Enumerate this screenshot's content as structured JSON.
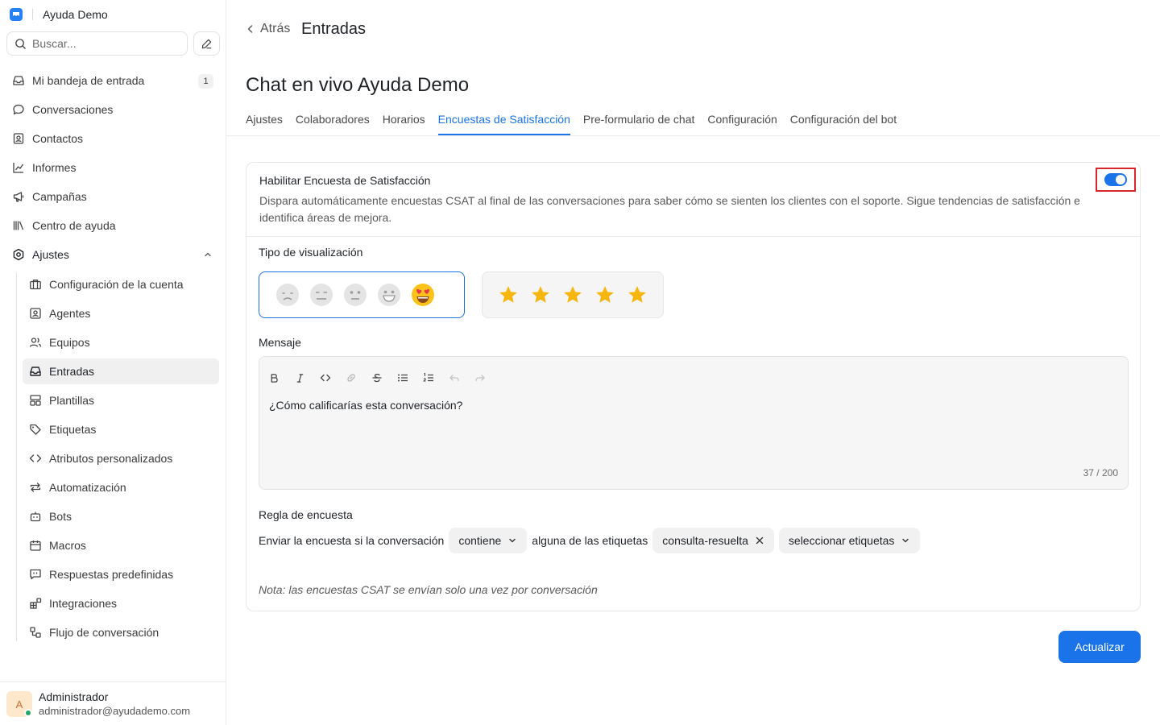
{
  "app": {
    "name": "Ayuda Demo"
  },
  "search": {
    "placeholder": "Buscar..."
  },
  "sidebar": {
    "items": [
      {
        "label": "Mi bandeja de entrada",
        "badge": "1"
      },
      {
        "label": "Conversaciones"
      },
      {
        "label": "Contactos"
      },
      {
        "label": "Informes"
      },
      {
        "label": "Campañas"
      },
      {
        "label": "Centro de ayuda"
      },
      {
        "label": "Ajustes"
      }
    ],
    "settings": [
      {
        "label": "Configuración de la cuenta"
      },
      {
        "label": "Agentes"
      },
      {
        "label": "Equipos"
      },
      {
        "label": "Entradas"
      },
      {
        "label": "Plantillas"
      },
      {
        "label": "Etiquetas"
      },
      {
        "label": "Atributos personalizados"
      },
      {
        "label": "Automatización"
      },
      {
        "label": "Bots"
      },
      {
        "label": "Macros"
      },
      {
        "label": "Respuestas predefinidas"
      },
      {
        "label": "Integraciones"
      },
      {
        "label": "Flujo de conversación"
      }
    ]
  },
  "profile": {
    "initial": "A",
    "name": "Administrador",
    "email": "administrador@ayudademo.com",
    "status": "online"
  },
  "header": {
    "back_label": "Atrás",
    "title": "Entradas"
  },
  "page": {
    "title": "Chat en vivo Ayuda Demo",
    "tabs": [
      {
        "label": "Ajustes"
      },
      {
        "label": "Colaboradores"
      },
      {
        "label": "Horarios"
      },
      {
        "label": "Encuestas de Satisfacción",
        "active": true
      },
      {
        "label": "Pre-formulario de chat"
      },
      {
        "label": "Configuración"
      },
      {
        "label": "Configuración del bot"
      }
    ]
  },
  "csat": {
    "enable_title": "Habilitar Encuesta de Satisfacción",
    "enable_desc": "Dispara automáticamente encuestas CSAT al final de las conversaciones para saber cómo se sienten los clientes con el soporte. Sigue tendencias de satisfacción e identifica áreas de mejora.",
    "enabled": true,
    "display_type_label": "Tipo de visualización",
    "display_options": [
      "emoji",
      "star"
    ],
    "selected_display": "emoji",
    "message_label": "Mensaje",
    "message_value": "¿Cómo calificarías esta conversación?",
    "char_counter": "37 / 200",
    "rule_label": "Regla de encuesta",
    "rule": {
      "prefix": "Enviar la encuesta si la conversación",
      "operator": "contiene",
      "middle": "alguna de las etiquetas",
      "tag": "consulta-resuelta",
      "select_placeholder": "seleccionar etiquetas"
    },
    "note": "Nota: las encuestas CSAT se envían solo una vez por conversación"
  },
  "actions": {
    "update_label": "Actualizar"
  },
  "colors": {
    "accent": "#1a73e8",
    "highlight_box": "#d9262c",
    "star": "#f6b60f"
  }
}
